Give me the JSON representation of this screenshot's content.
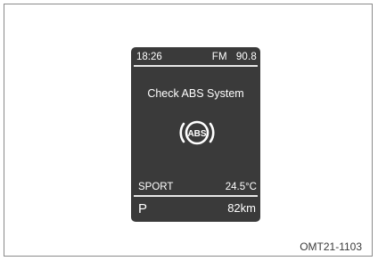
{
  "display": {
    "time": "18:26",
    "radio_band": "FM",
    "radio_freq": "90.8",
    "message": "Check ABS System",
    "warning_icon": {
      "name": "abs-warning-icon",
      "text": "ABS"
    },
    "drive_mode": "SPORT",
    "temperature": "24.5°C",
    "gear": "P",
    "range": "82km"
  },
  "figure_code": "OMT21-1103",
  "colors": {
    "lcd_background": "#3a3a3a",
    "lcd_text": "#ffffff",
    "frame_border": "#8a8a8a"
  }
}
